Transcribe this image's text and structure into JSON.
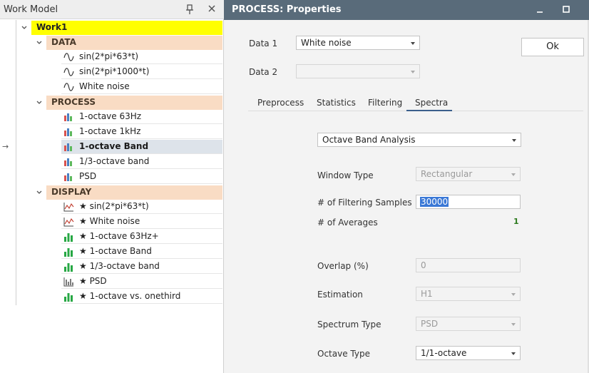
{
  "work_model": {
    "title": "Work Model",
    "root": "Work1",
    "data": {
      "label": "DATA",
      "items": [
        "sin(2*pi*63*t)",
        "sin(2*pi*1000*t)",
        "White noise"
      ]
    },
    "process": {
      "label": "PROCESS",
      "items": [
        "1-octave 63Hz",
        "1-octave 1kHz",
        "1-octave Band",
        "1/3-octave band",
        "PSD"
      ],
      "selected": "1-octave Band"
    },
    "display": {
      "label": "DISPLAY",
      "items": [
        "★ sin(2*pi*63*t)",
        "★ White noise",
        "★ 1-octave 63Hz+",
        "★ 1-octave Band",
        "★ 1/3-octave band",
        "★ PSD",
        "★ 1-octave vs. onethird"
      ]
    }
  },
  "properties": {
    "title": "PROCESS: Properties",
    "data1_label": "Data 1",
    "data1_value": "White noise",
    "data2_label": "Data 2",
    "data2_value": "",
    "ok_label": "Ok",
    "tabs": [
      "Preprocess",
      "Statistics",
      "Filtering",
      "Spectra"
    ],
    "active_tab": "Spectra",
    "analysis_value": "Octave Band Analysis",
    "window_type_label": "Window Type",
    "window_type_value": "Rectangular",
    "filtering_samples_label": "# of Filtering Samples",
    "filtering_samples_value": "30000",
    "averages_label": "# of Averages",
    "averages_value": "1",
    "overlap_label": "Overlap (%)",
    "overlap_value": "0",
    "estimation_label": "Estimation",
    "estimation_value": "H1",
    "spectrum_type_label": "Spectrum Type",
    "spectrum_type_value": "PSD",
    "octave_type_label": "Octave Type",
    "octave_type_value": "1/1-octave"
  },
  "colors": {
    "root_highlight": "#ffff00",
    "group_header": "#f9dcc4",
    "titlebar": "#596b7a",
    "selected_row": "#dde3ea",
    "accent": "#3a78d6"
  },
  "icons": {
    "data": "sine-wave-icon",
    "process": "bar-chart-icon",
    "display_line": "line-chart-icon",
    "display_bar": "green-bar-chart-icon",
    "display_psd": "psd-chart-icon"
  }
}
